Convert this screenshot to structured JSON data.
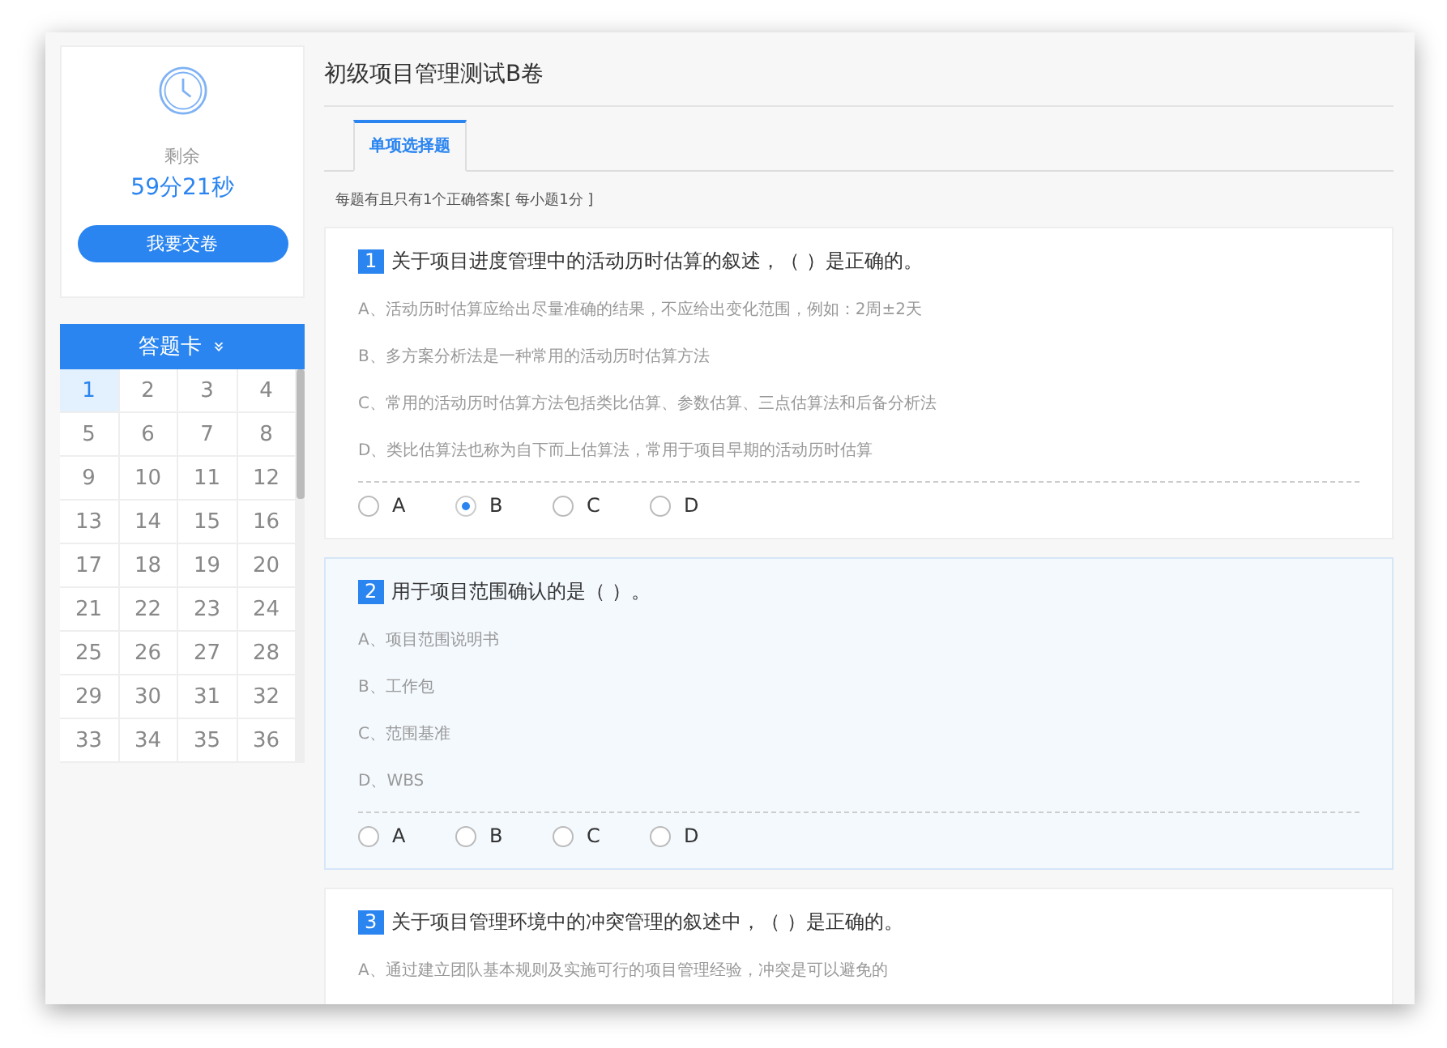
{
  "timer": {
    "label": "剩余",
    "remaining": "59分21秒",
    "submit": "我要交卷"
  },
  "answer_card": {
    "title": "答题卡",
    "toggle": "»",
    "cells": [
      {
        "label": "1",
        "selected": true
      },
      {
        "label": "2",
        "selected": false
      },
      {
        "label": "3",
        "selected": false
      },
      {
        "label": "4",
        "selected": false
      },
      {
        "label": "5",
        "selected": false
      },
      {
        "label": "6",
        "selected": false
      },
      {
        "label": "7",
        "selected": false
      },
      {
        "label": "8",
        "selected": false
      },
      {
        "label": "9",
        "selected": false
      },
      {
        "label": "10",
        "selected": false
      },
      {
        "label": "11",
        "selected": false
      },
      {
        "label": "12",
        "selected": false
      },
      {
        "label": "13",
        "selected": false
      },
      {
        "label": "14",
        "selected": false
      },
      {
        "label": "15",
        "selected": false
      },
      {
        "label": "16",
        "selected": false
      },
      {
        "label": "17",
        "selected": false
      },
      {
        "label": "18",
        "selected": false
      },
      {
        "label": "19",
        "selected": false
      },
      {
        "label": "20",
        "selected": false
      },
      {
        "label": "21",
        "selected": false
      },
      {
        "label": "22",
        "selected": false
      },
      {
        "label": "23",
        "selected": false
      },
      {
        "label": "24",
        "selected": false
      },
      {
        "label": "25",
        "selected": false
      },
      {
        "label": "26",
        "selected": false
      },
      {
        "label": "27",
        "selected": false
      },
      {
        "label": "28",
        "selected": false
      },
      {
        "label": "29",
        "selected": false
      },
      {
        "label": "30",
        "selected": false
      },
      {
        "label": "31",
        "selected": false
      },
      {
        "label": "32",
        "selected": false
      },
      {
        "label": "33",
        "selected": false
      },
      {
        "label": "34",
        "selected": false
      },
      {
        "label": "35",
        "selected": false
      },
      {
        "label": "36",
        "selected": false
      }
    ]
  },
  "title": "初级项目管理测试B卷",
  "tabs": [
    {
      "label": "单项选择题",
      "selected": true
    }
  ],
  "instruction": "每题有且只有1个正确答案[ 每小题1分 ]",
  "questions": [
    {
      "number": "1",
      "text": "关于项目进度管理中的活动历时估算的叙述，（ ）是正确的。",
      "highlighted": false,
      "options": [
        "A、活动历时估算应给出尽量准确的结果，不应给出变化范围，例如：2周±2天",
        "B、多方案分析法是一种常用的活动历时估算方法",
        "C、常用的活动历时估算方法包括类比估算、参数估算、三点估算法和后备分析法",
        "D、类比估算法也称为自下而上估算法，常用于项目早期的活动历时估算"
      ],
      "choices": [
        {
          "label": "A",
          "selected": false
        },
        {
          "label": "B",
          "selected": true
        },
        {
          "label": "C",
          "selected": false
        },
        {
          "label": "D",
          "selected": false
        }
      ]
    },
    {
      "number": "2",
      "text": "用于项目范围确认的是（ ）。",
      "highlighted": true,
      "options": [
        "A、项目范围说明书",
        "B、工作包",
        "C、范围基准",
        "D、WBS"
      ],
      "choices": [
        {
          "label": "A",
          "selected": false
        },
        {
          "label": "B",
          "selected": false
        },
        {
          "label": "C",
          "selected": false
        },
        {
          "label": "D",
          "selected": false
        }
      ]
    },
    {
      "number": "3",
      "text": "关于项目管理环境中的冲突管理的叙述中，（ ）是正确的。",
      "highlighted": false,
      "options": [
        "A、通过建立团队基本规则及实施可行的项目管理经验，冲突是可以避免的"
      ]
    }
  ]
}
